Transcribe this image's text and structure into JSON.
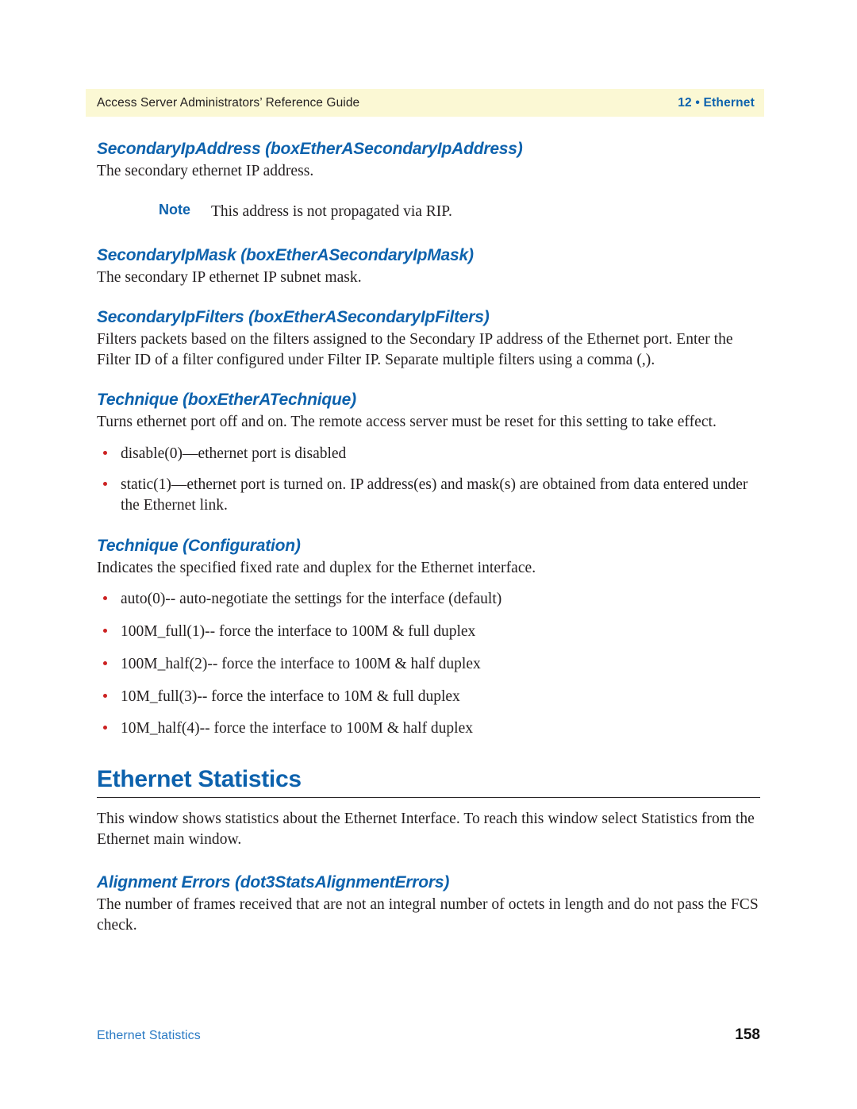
{
  "header": {
    "left_text": "Access Server Administrators’ Reference Guide",
    "right_text": "12 • Ethernet",
    "band_color": "#FBF8D4",
    "accent_color": "#0d62ad"
  },
  "sections": [
    {
      "heading": "SecondaryIpAddress (boxEtherASecondaryIpAddress)",
      "body": "The secondary ethernet IP address."
    },
    {
      "heading": "SecondaryIpMask (boxEtherASecondaryIpMask)",
      "body": "The secondary IP ethernet IP subnet mask."
    },
    {
      "heading": "SecondaryIpFilters (boxEtherASecondaryIpFilters)",
      "body": "Filters packets based on the filters assigned to the Secondary IP address of the Ethernet port. Enter the Filter ID of a filter configured under Filter IP. Separate multiple filters using a comma (,)."
    },
    {
      "heading": "Technique (boxEtherATechnique)",
      "body": "Turns ethernet port off and on. The remote access server must be reset for this setting to take effect."
    },
    {
      "heading": "Technique (Configuration)",
      "body": "Indicates the specified fixed rate and duplex for the Ethernet interface."
    },
    {
      "heading": "Alignment Errors (dot3StatsAlignmentErrors)",
      "body": "The number of frames received that are not an integral number of octets in length and do not pass the FCS check."
    }
  ],
  "note": {
    "label": "Note",
    "text": "This address is not propagated via RIP."
  },
  "technique_bullets": [
    "disable(0)—ethernet port is disabled",
    "static(1)—ethernet port is turned on.  IP address(es) and mask(s) are obtained from data entered under the Ethernet link."
  ],
  "configuration_bullets": [
    "auto(0)-- auto-negotiate the settings for the interface (default)",
    "100M_full(1)-- force the interface to 100M & full duplex",
    "100M_half(2)-- force the interface to 100M & half duplex",
    "10M_full(3)-- force the interface to 10M & full duplex",
    "10M_half(4)-- force the interface to 100M & half duplex"
  ],
  "ethernet_statistics": {
    "title": "Ethernet Statistics",
    "body": "This window shows statistics about the Ethernet Interface.  To reach this window select Statistics from the Ethernet main window."
  },
  "footer": {
    "left_text": "Ethernet Statistics",
    "page_number": "158"
  },
  "bullet_color": "#cc2222"
}
